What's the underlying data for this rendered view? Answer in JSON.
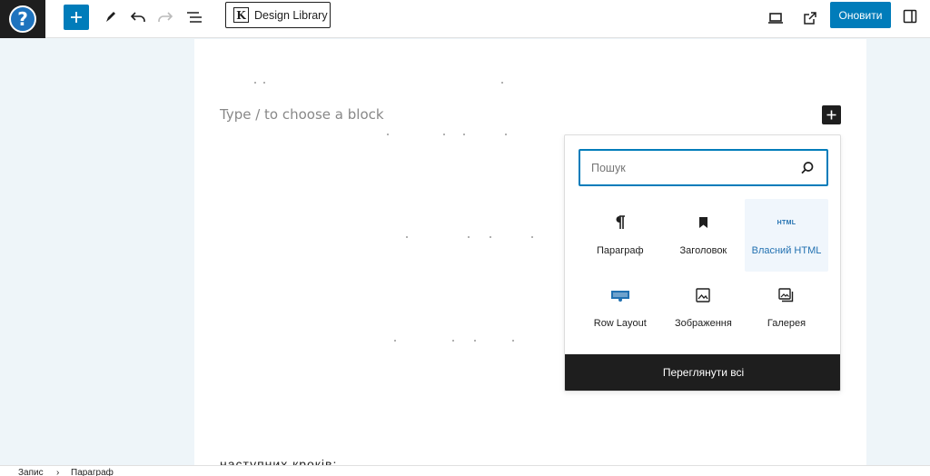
{
  "toolbar": {
    "logo_glyph": "?",
    "design_library_icon": "K",
    "design_library_label": "Design Library",
    "publish_label": "Оновити"
  },
  "canvas": {
    "placeholder": "Type / to choose a block",
    "bottom_text": "наступних кроків:"
  },
  "inserter": {
    "search_placeholder": "Пошук",
    "blocks": [
      {
        "label": "Параграф",
        "icon": "paragraph-icon"
      },
      {
        "label": "Заголовок",
        "icon": "bookmark-icon"
      },
      {
        "label": "Власний HTML",
        "icon": "html-icon",
        "icon_text": "HTML",
        "active": true
      },
      {
        "label": "Row Layout",
        "icon": "row-layout-icon"
      },
      {
        "label": "Зображення",
        "icon": "image-icon"
      },
      {
        "label": "Галерея",
        "icon": "gallery-icon"
      }
    ],
    "browse_all_label": "Переглянути всі"
  },
  "breadcrumb": {
    "items": [
      "Запис",
      "Параграф"
    ],
    "separator": "›"
  },
  "colors": {
    "accent": "#007cba",
    "dark": "#1e1e1e",
    "canvas_bg": "#eef5f9",
    "active_block_bg": "#f0f6fc"
  }
}
